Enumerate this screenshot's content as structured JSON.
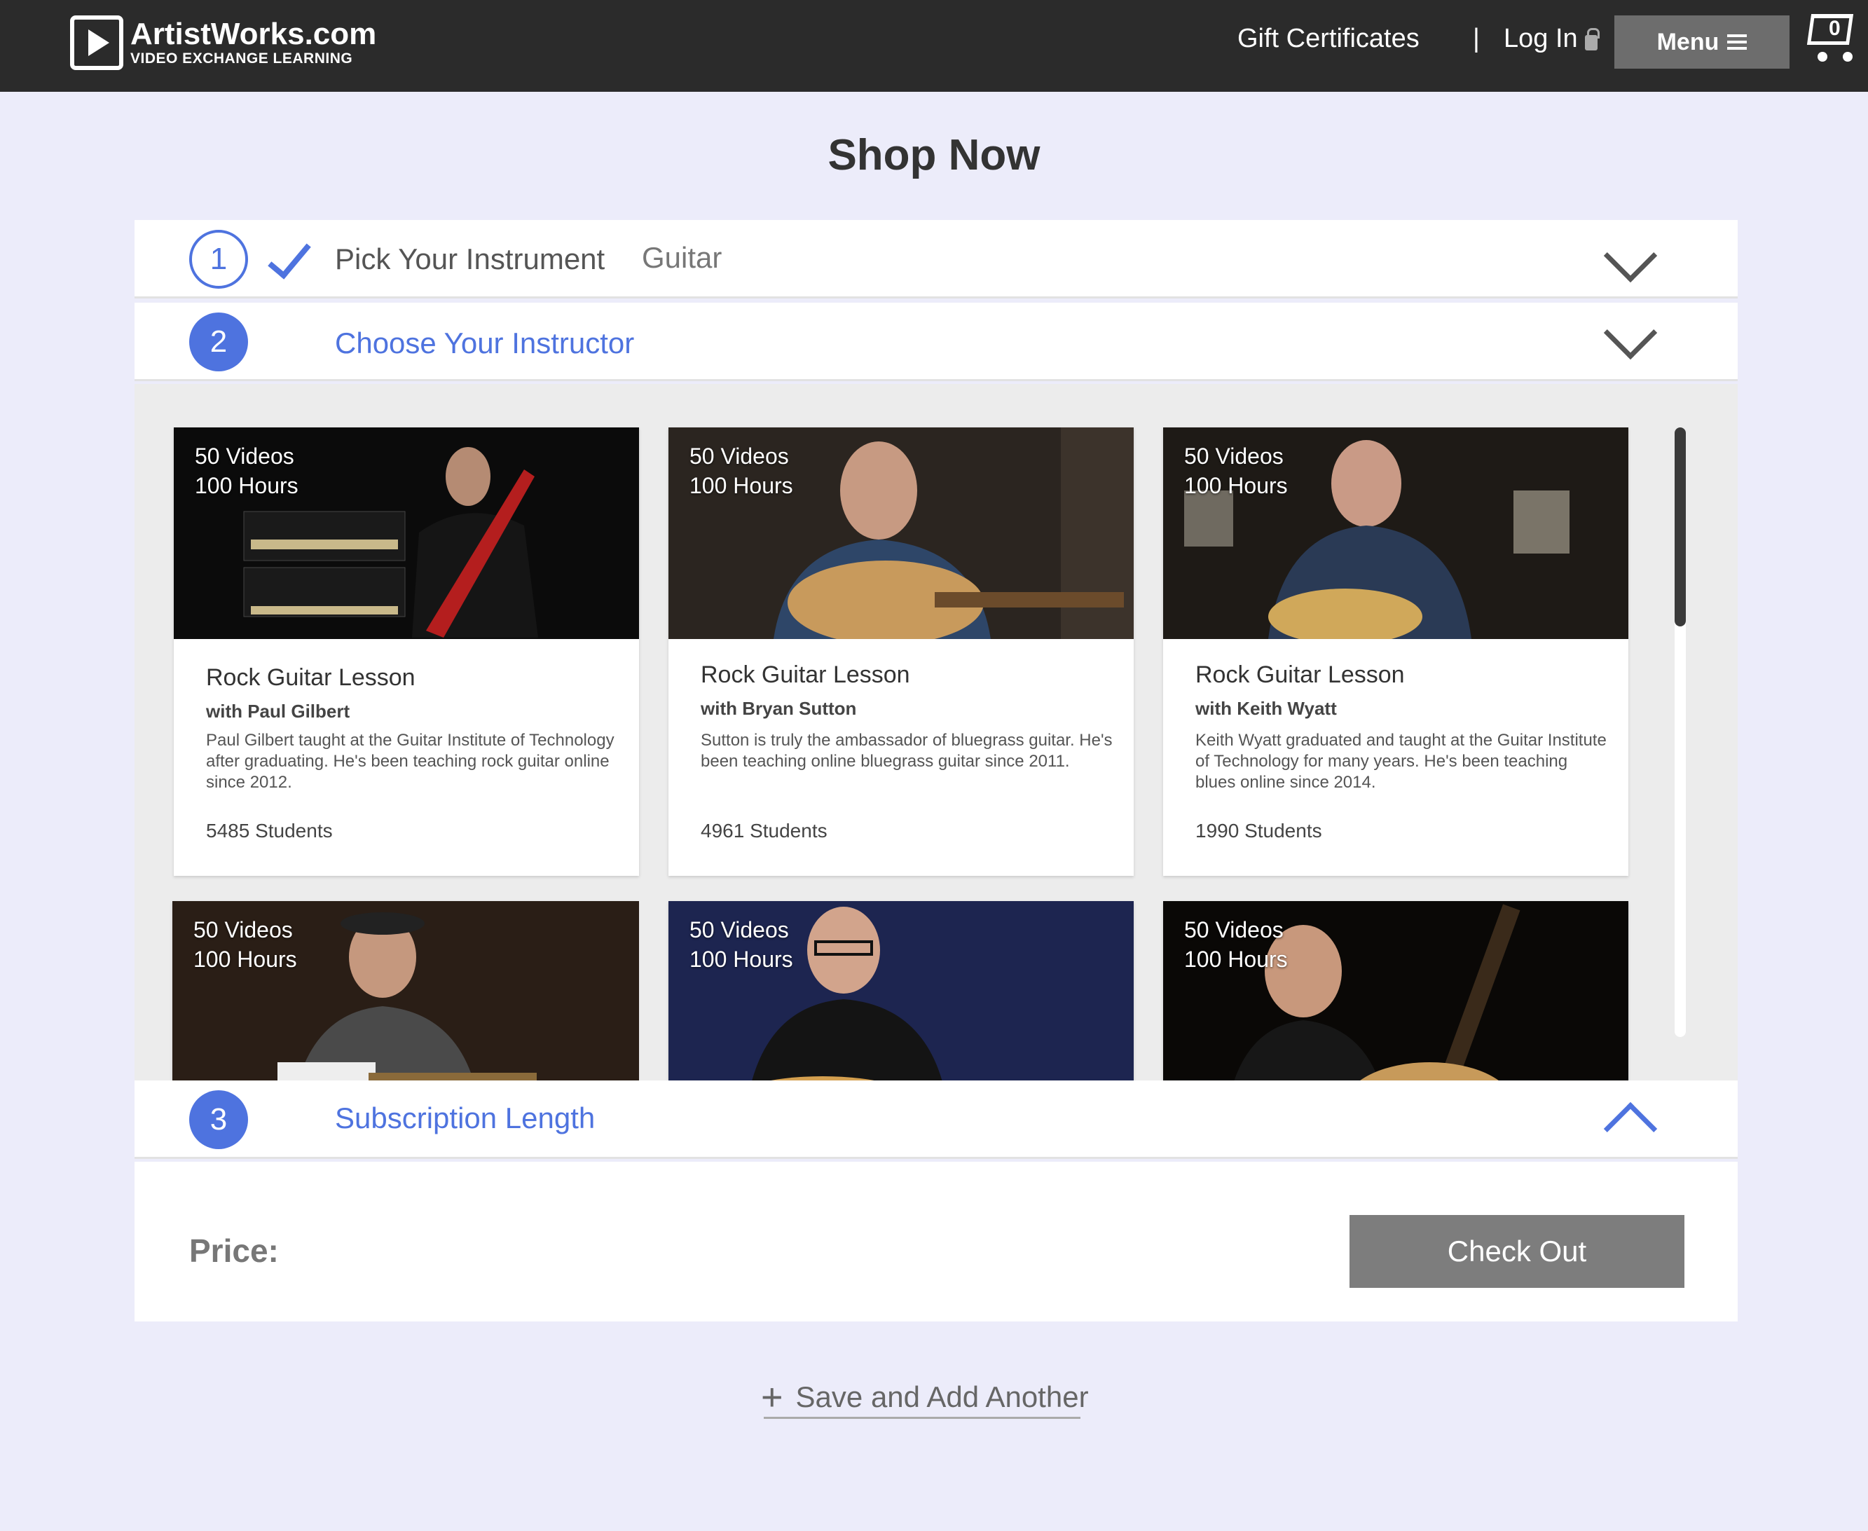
{
  "header": {
    "logo_name": "ArtistWorks.com",
    "logo_tagline": "VIDEO EXCHANGE LEARNING",
    "gift_certificates": "Gift Certificates",
    "separator": "|",
    "log_in": "Log In",
    "menu_label": "Menu",
    "cart_count": "0"
  },
  "page_title": "Shop Now",
  "steps": [
    {
      "number": "1",
      "label": "Pick Your Instrument",
      "value": "Guitar",
      "state": "done"
    },
    {
      "number": "2",
      "label": "Choose Your Instructor",
      "state": "active"
    },
    {
      "number": "3",
      "label": "Subscription Length",
      "state": "active"
    }
  ],
  "instructors": [
    {
      "videos": "50 Videos",
      "hours": "100 Hours",
      "title": "Rock Guitar Lesson",
      "with": "with Paul Gilbert",
      "desc": "Paul Gilbert taught at the Guitar Institute of Technology after graduating. He's been teaching rock guitar online since 2012.",
      "students": "5485 Students"
    },
    {
      "videos": "50 Videos",
      "hours": "100 Hours",
      "title": "Rock Guitar Lesson",
      "with": "with Bryan Sutton",
      "desc": "Sutton is truly the ambassador of bluegrass guitar. He's been teaching online bluegrass guitar since 2011.",
      "students": "4961 Students"
    },
    {
      "videos": "50 Videos",
      "hours": "100 Hours",
      "title": "Rock Guitar Lesson",
      "with": "with Keith Wyatt",
      "desc": "Keith Wyatt graduated and taught at the Guitar Institute of Technology for many years. He's been teaching blues online since 2014.",
      "students": "1990 Students"
    },
    {
      "videos": "50 Videos",
      "hours": "100 Hours"
    },
    {
      "videos": "50 Videos",
      "hours": "100 Hours"
    },
    {
      "videos": "50 Videos",
      "hours": "100 Hours"
    }
  ],
  "subscription": {
    "price_label": "Price:",
    "checkout_label": "Check Out"
  },
  "save_another": "Save and Add Another",
  "colors": {
    "accent": "#4e73df",
    "topbar": "#2b2b2b",
    "page_bg": "#ececfa",
    "button_gray": "#7d7d7d"
  }
}
